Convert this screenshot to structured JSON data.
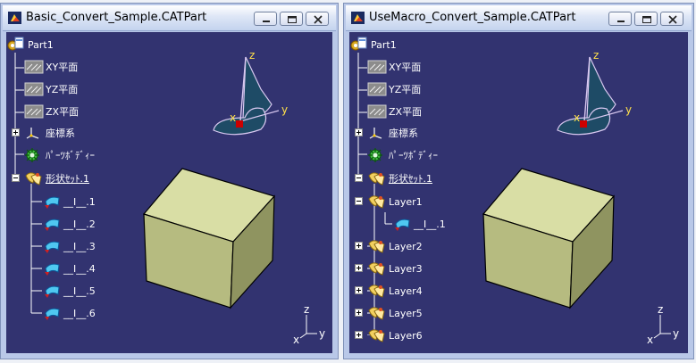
{
  "left_window": {
    "title": "Basic_Convert_Sample.CATPart",
    "tree": [
      {
        "label": "Part1",
        "icon": "part-icon"
      },
      {
        "label": "XY平面",
        "icon": "plane-icon"
      },
      {
        "label": "YZ平面",
        "icon": "plane-icon"
      },
      {
        "label": "ZX平面",
        "icon": "plane-icon"
      },
      {
        "label": "座標系",
        "icon": "axis-system-icon"
      },
      {
        "label": "ﾊﾟｰﾂﾎﾞﾃﾞｨｰ",
        "icon": "part-body-icon"
      },
      {
        "label": "形状ｾｯﾄ.1",
        "icon": "geometrical-set-icon"
      },
      {
        "label": "__I__.1",
        "icon": "surface-icon"
      },
      {
        "label": "__I__.2",
        "icon": "surface-icon"
      },
      {
        "label": "__I__.3",
        "icon": "surface-icon"
      },
      {
        "label": "__I__.4",
        "icon": "surface-icon"
      },
      {
        "label": "__I__.5",
        "icon": "surface-icon"
      },
      {
        "label": "__I__.6",
        "icon": "surface-icon"
      }
    ]
  },
  "right_window": {
    "title": "UseMacro_Convert_Sample.CATPart",
    "tree": [
      {
        "label": "Part1",
        "icon": "part-icon"
      },
      {
        "label": "XY平面",
        "icon": "plane-icon"
      },
      {
        "label": "YZ平面",
        "icon": "plane-icon"
      },
      {
        "label": "ZX平面",
        "icon": "plane-icon"
      },
      {
        "label": "座標系",
        "icon": "axis-system-icon"
      },
      {
        "label": "ﾊﾟｰﾂﾎﾞﾃﾞｨｰ",
        "icon": "part-body-icon"
      },
      {
        "label": "形状ｾｯﾄ.1",
        "icon": "geometrical-set-icon"
      },
      {
        "label": "Layer1",
        "icon": "geometrical-set-icon"
      },
      {
        "label": "__I__.1",
        "icon": "surface-icon"
      },
      {
        "label": "Layer2",
        "icon": "geometrical-set-icon"
      },
      {
        "label": "Layer3",
        "icon": "geometrical-set-icon"
      },
      {
        "label": "Layer4",
        "icon": "geometrical-set-icon"
      },
      {
        "label": "Layer5",
        "icon": "geometrical-set-icon"
      },
      {
        "label": "Layer6",
        "icon": "geometrical-set-icon"
      }
    ]
  },
  "compass_labels": {
    "x": "x",
    "y": "y",
    "z": "z"
  },
  "axis_labels": {
    "x": "x",
    "y": "y",
    "z": "z"
  },
  "colors": {
    "viewport_bg": "#323370",
    "cube_top": "#d9dea5",
    "cube_front": "#b6bb80",
    "cube_side": "#8f9460",
    "compass": "#1e4b66",
    "accent": "#cc0000"
  }
}
